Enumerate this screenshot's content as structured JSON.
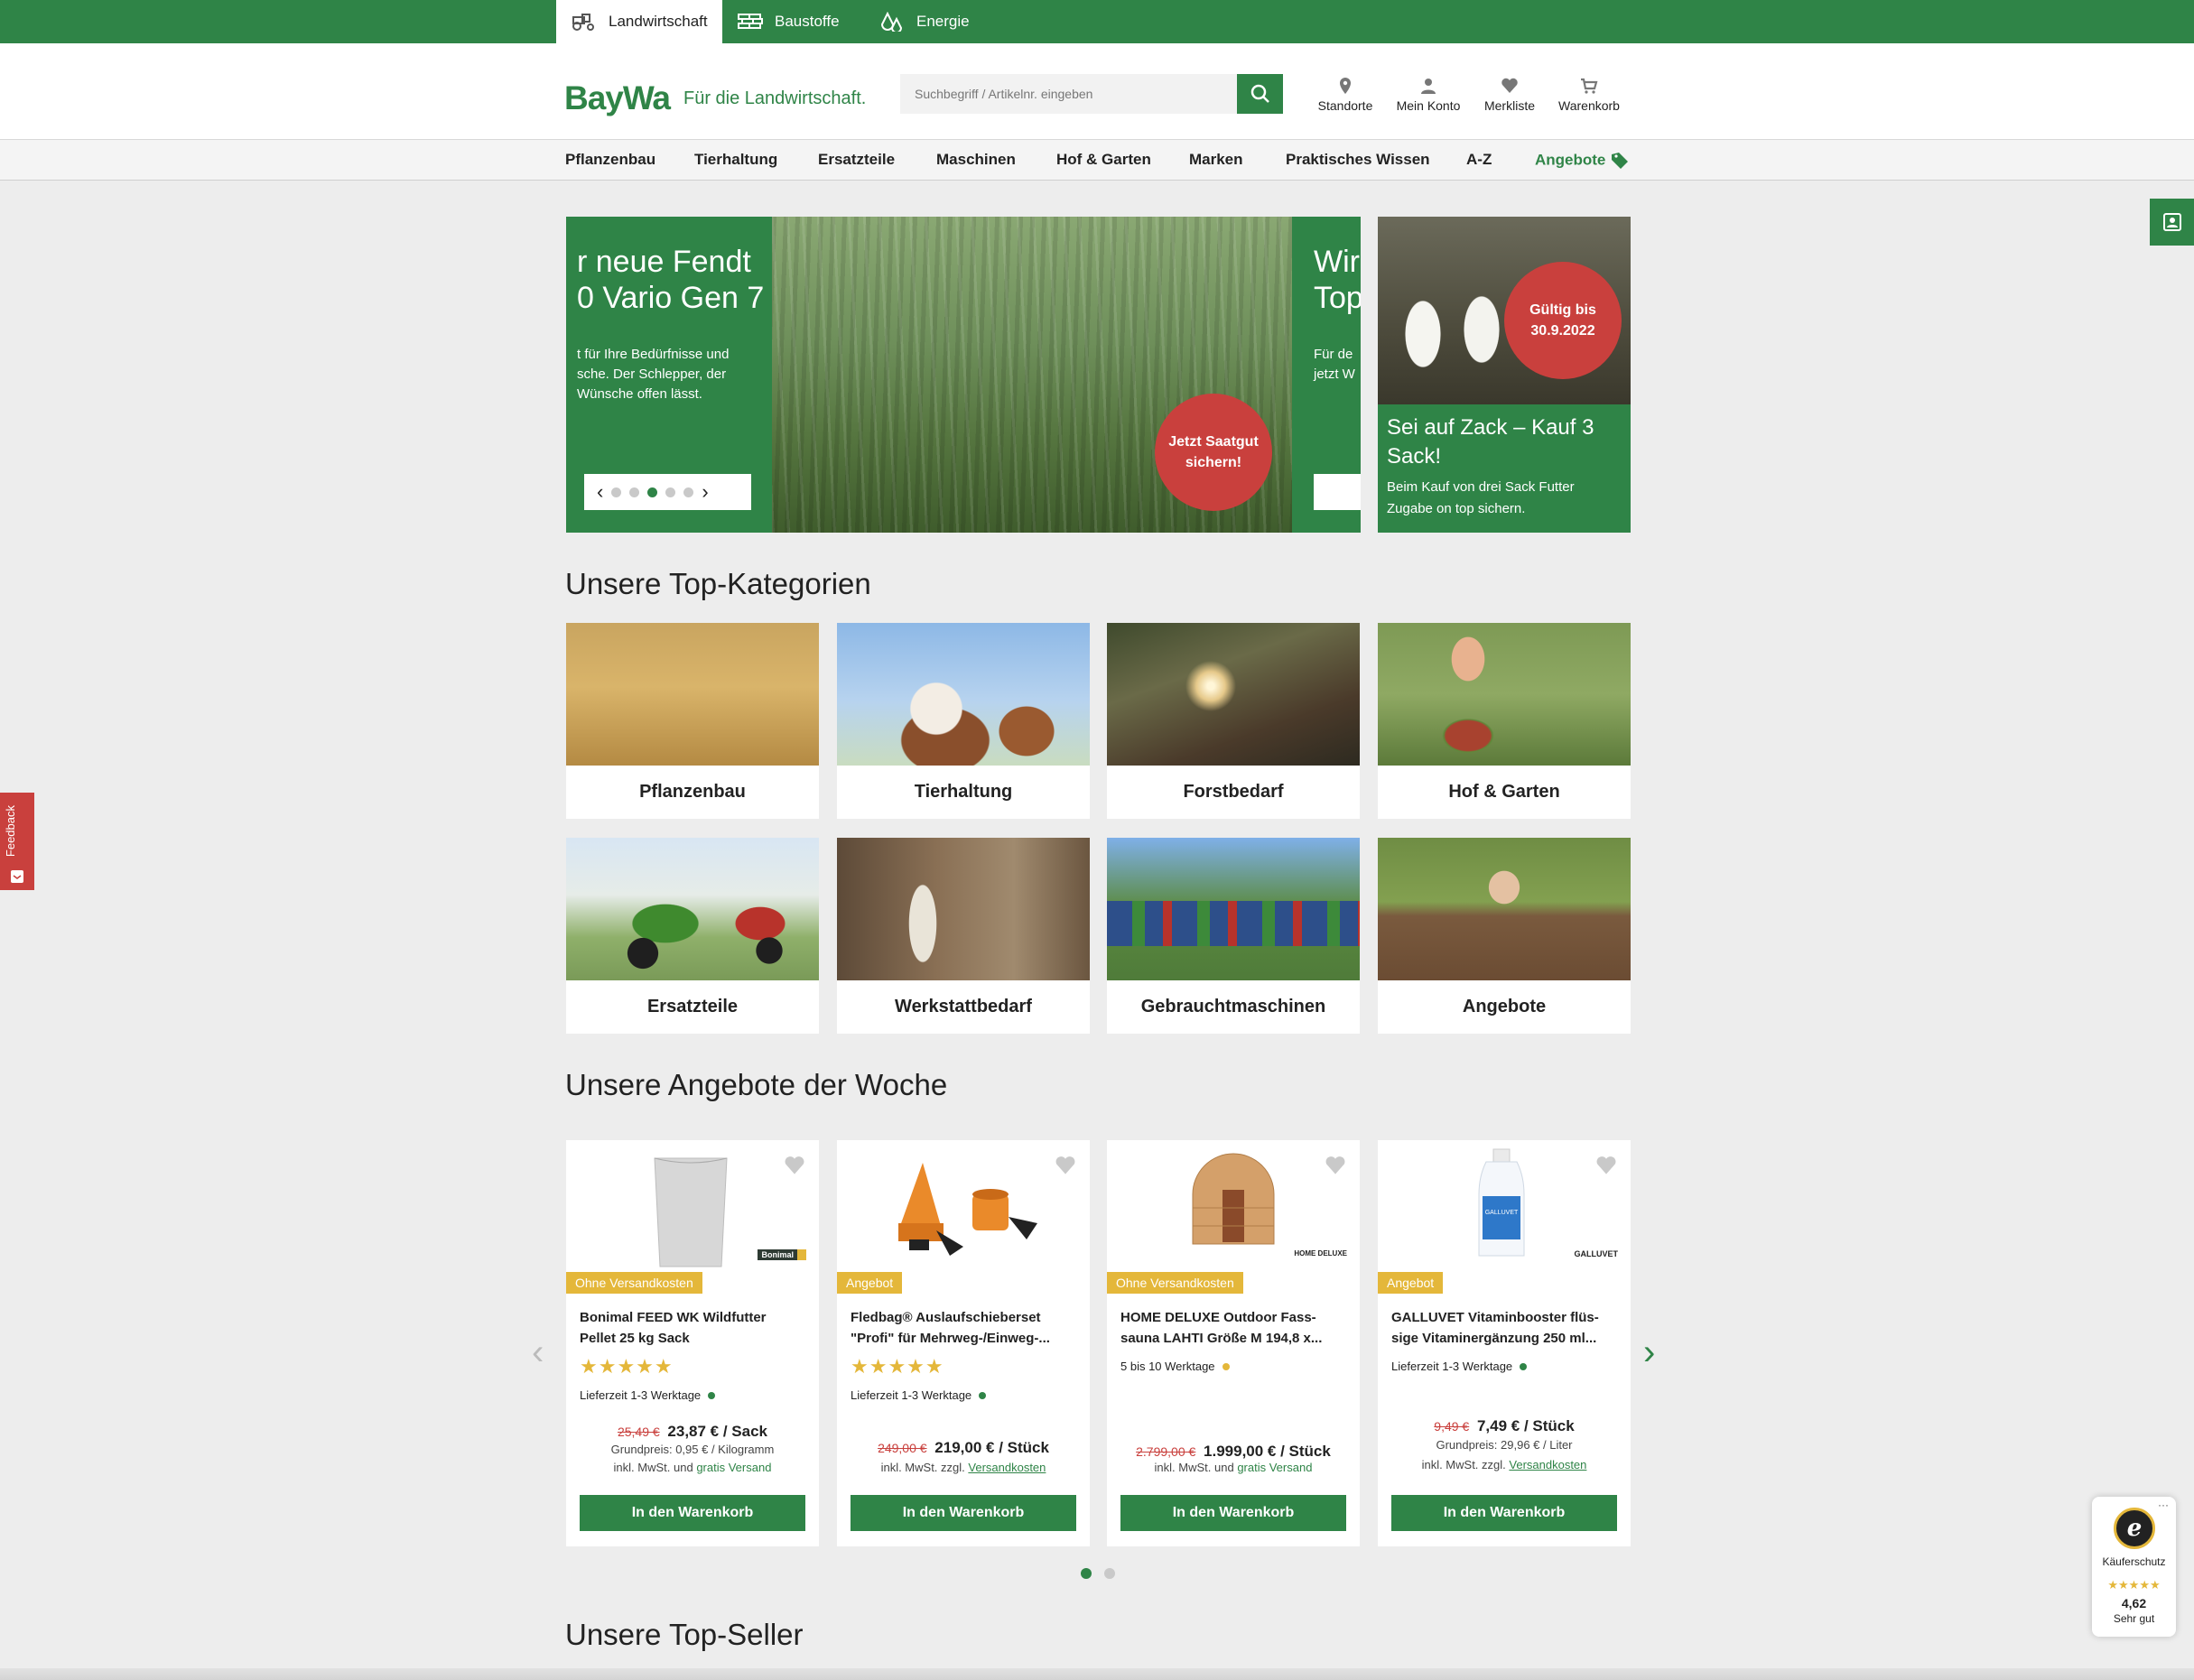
{
  "colors": {
    "brand_green": "#2f8447",
    "sale_red": "#c9403d",
    "star_yellow": "#e4b73a",
    "background": "#ededed"
  },
  "topbar": {
    "tabs": [
      {
        "label": "Landwirtschaft",
        "icon": "tractor-icon",
        "active": true
      },
      {
        "label": "Baustoffe",
        "icon": "bricks-icon",
        "active": false
      },
      {
        "label": "Energie",
        "icon": "energy-drops-icon",
        "active": false
      }
    ]
  },
  "header": {
    "logo": "BayWa",
    "tagline": "Für die Landwirtschaft.",
    "search": {
      "placeholder": "Suchbegriff / Artikelnr. eingeben",
      "icon": "search-icon"
    },
    "icons": [
      {
        "label": "Standorte",
        "icon": "location-pin-icon"
      },
      {
        "label": "Mein Konto",
        "icon": "user-icon"
      },
      {
        "label": "Merkliste",
        "icon": "heart-icon"
      },
      {
        "label": "Warenkorb",
        "icon": "cart-icon"
      }
    ]
  },
  "nav": {
    "items": [
      "Pflanzenbau",
      "Tierhaltung",
      "Ersatzteile",
      "Maschinen",
      "Hof & Garten",
      "Marken",
      "Praktisches Wissen",
      "A-Z"
    ],
    "offers": "Angebote",
    "offers_icon": "price-tag-icon"
  },
  "hero": {
    "panel_title": "r neue Fendt\n0 Vario Gen 7",
    "panel_text": "t für Ihre Bedürfnisse und\nsche. Der Schlepper, der\nWünsche offen lässt.",
    "badge": "Jetzt Saatgut\nsichern!",
    "next_title": "Wir\nTop",
    "next_text": "Für de\njetzt W",
    "slide_count": 5,
    "active_slide": 3
  },
  "promo": {
    "badge": "Gültig bis\n30.9.2022",
    "title": "Sei auf Zack – Kauf 3\nSack!",
    "text": "Beim Kauf von drei Sack Futter\nZugabe on top sichern."
  },
  "sections": {
    "categories_title": "Unsere Top-Kategorien",
    "offers_title": "Unsere Angebote der Woche",
    "topseller_title": "Unsere Top-Seller"
  },
  "categories": [
    "Pflanzenbau",
    "Tierhaltung",
    "Forstbedarf",
    "Hof & Garten",
    "Ersatzteile",
    "Werkstattbedarf",
    "Gebrauchtmaschinen",
    "Angebote"
  ],
  "products": [
    {
      "badge": "Ohne Versandkosten",
      "brand": "Bonimal",
      "title": "Bonimal FEED WK Wildfutter\nPellet 25 kg Sack",
      "rating": 5,
      "stars": "★★★★★",
      "delivery": "Lieferzeit 1-3 Werktage",
      "delivery_status": "green",
      "old_price": "25,49 €",
      "price": "23,87 € / Sack",
      "base_price": "Grundpreis:  0,95 € / Kilogramm",
      "tax_prefix": "inkl. MwSt. und",
      "tax_link": "gratis Versand",
      "button": "In den Warenkorb"
    },
    {
      "badge": "Angebot",
      "brand": "",
      "title": "Fledbag® Auslaufschieberset\n\"Profi\" für Mehrweg-/Einweg-...",
      "rating": 5,
      "stars": "★★★★★",
      "delivery": "Lieferzeit 1-3 Werktage",
      "delivery_status": "green",
      "old_price": "249,00 €",
      "price": "219,00 € / Stück",
      "base_price": "",
      "tax_prefix": "inkl. MwSt. zzgl.",
      "tax_link": "Versandkosten",
      "button": "In den Warenkorb"
    },
    {
      "badge": "Ohne Versandkosten",
      "brand": "HOME DELUXE",
      "title": "HOME DELUXE Outdoor Fass-\nsauna LAHTI Größe M 194,8 x...",
      "rating": 0,
      "stars": "",
      "delivery": "5 bis 10 Werktage",
      "delivery_status": "yellow",
      "old_price": "2.799,00 €",
      "price": "1.999,00 € / Stück",
      "base_price": "",
      "tax_prefix": "inkl. MwSt. und",
      "tax_link": "gratis Versand",
      "button": "In den Warenkorb"
    },
    {
      "badge": "Angebot",
      "brand": "GALLUVET",
      "title": "GALLUVET Vitaminbooster flüs-\nsige Vitaminergänzung 250 ml...",
      "rating": 0,
      "stars": "",
      "delivery": "Lieferzeit 1-3 Werktage",
      "delivery_status": "green",
      "old_price": "9,49 €",
      "price": "7,49 € / Stück",
      "base_price": "Grundpreis:  29,96 € / Liter",
      "tax_prefix": "inkl. MwSt. zzgl.",
      "tax_link": "Versandkosten",
      "button": "In den Warenkorb"
    }
  ],
  "carousel": {
    "pages": 2,
    "active_page": 1
  },
  "feedback": {
    "label": "Feedback"
  },
  "contact": {
    "icon": "support-agent-icon"
  },
  "trust": {
    "label": "Käuferschutz",
    "stars": "★★★★★",
    "score": "4,62",
    "rating_text": "Sehr gut",
    "seal": "e",
    "menu": "···"
  }
}
